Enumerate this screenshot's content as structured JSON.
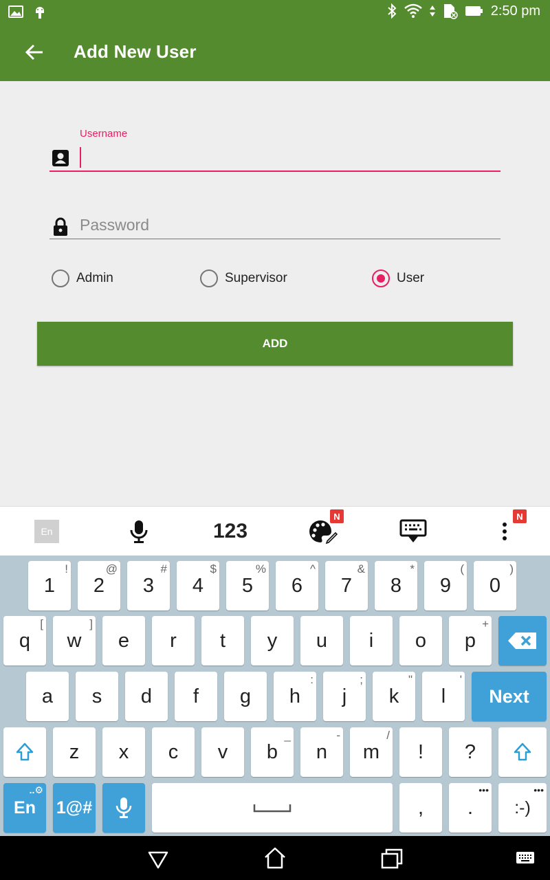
{
  "status_bar": {
    "time": "2:50 pm"
  },
  "app_bar": {
    "title": "Add New User"
  },
  "form": {
    "username_label": "Username",
    "username_value": "",
    "password_placeholder": "Password",
    "roles": [
      {
        "label": "Admin",
        "selected": false
      },
      {
        "label": "Supervisor",
        "selected": false
      },
      {
        "label": "User",
        "selected": true
      }
    ],
    "add_button": "ADD"
  },
  "keyboard_toolbar": {
    "lang": "En",
    "numbers": "123",
    "badge": "N"
  },
  "keyboard": {
    "row1": [
      {
        "k": "1",
        "s": "!"
      },
      {
        "k": "2",
        "s": "@"
      },
      {
        "k": "3",
        "s": "#"
      },
      {
        "k": "4",
        "s": "$"
      },
      {
        "k": "5",
        "s": "%"
      },
      {
        "k": "6",
        "s": "^"
      },
      {
        "k": "7",
        "s": "&"
      },
      {
        "k": "8",
        "s": "*"
      },
      {
        "k": "9",
        "s": "("
      },
      {
        "k": "0",
        "s": ")"
      }
    ],
    "row2": [
      {
        "k": "q",
        "s": "["
      },
      {
        "k": "w",
        "s": "]"
      },
      {
        "k": "e",
        "s": ""
      },
      {
        "k": "r",
        "s": ""
      },
      {
        "k": "t",
        "s": ""
      },
      {
        "k": "y",
        "s": ""
      },
      {
        "k": "u",
        "s": ""
      },
      {
        "k": "i",
        "s": ""
      },
      {
        "k": "o",
        "s": ""
      },
      {
        "k": "p",
        "s": "+"
      }
    ],
    "row3": [
      {
        "k": "a",
        "s": ""
      },
      {
        "k": "s",
        "s": ""
      },
      {
        "k": "d",
        "s": ""
      },
      {
        "k": "f",
        "s": ""
      },
      {
        "k": "g",
        "s": ""
      },
      {
        "k": "h",
        "s": ":"
      },
      {
        "k": "j",
        "s": ";"
      },
      {
        "k": "k",
        "s": "\""
      },
      {
        "k": "l",
        "s": "'"
      }
    ],
    "next_label": "Next",
    "row4": [
      {
        "k": "z",
        "s": ""
      },
      {
        "k": "x",
        "s": ""
      },
      {
        "k": "c",
        "s": ""
      },
      {
        "k": "v",
        "s": ""
      },
      {
        "k": "b",
        "s": "_"
      },
      {
        "k": "n",
        "s": "-"
      },
      {
        "k": "m",
        "s": "/"
      },
      {
        "k": "!",
        "s": ""
      },
      {
        "k": "?",
        "s": ""
      }
    ],
    "lang_key": "En",
    "symbols_key": "1@#",
    "comma": ",",
    "period": ".",
    "smiley": ":-)"
  }
}
